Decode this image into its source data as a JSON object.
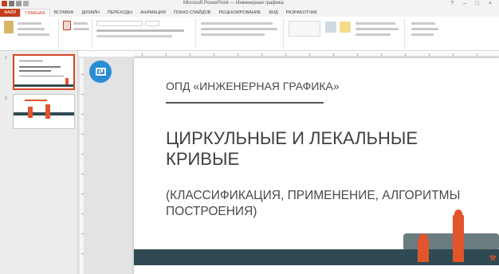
{
  "window": {
    "title": "Microsoft PowerPoint — Инженерная графика",
    "controls": "? – □ ×"
  },
  "ribbon": {
    "tabs": [
      "ФАЙЛ",
      "ГЛАВНАЯ",
      "ВСТАВКА",
      "ДИЗАЙН",
      "ПЕРЕХОДЫ",
      "АНИМАЦИЯ",
      "ПОКАЗ СЛАЙДОВ",
      "РЕЦЕНЗИРОВАНИЕ",
      "ВИД",
      "РАЗРАБОТЧИК"
    ],
    "active_tab_index": 1,
    "accent_color": "#c43e1c"
  },
  "thumbnails": [
    {
      "number": "1",
      "selected": true
    },
    {
      "number": "2",
      "selected": false
    }
  ],
  "slide": {
    "course": "ОПД «ИНЖЕНЕРНАЯ ГРАФИКА»",
    "title": "ЦИРКУЛЬНЫЕ И ЛЕКАЛЬНЫЕ КРИВЫЕ",
    "subtitle": "(КЛАССИФИКАЦИЯ, ПРИМЕНЕНИЕ, АЛГОРИТМЫ ПОСТРОЕНИЯ)",
    "band_color": "#2f4a52",
    "figure_color": "#e2542c"
  },
  "icons": {
    "presenter_badge": "presentation-icon"
  }
}
